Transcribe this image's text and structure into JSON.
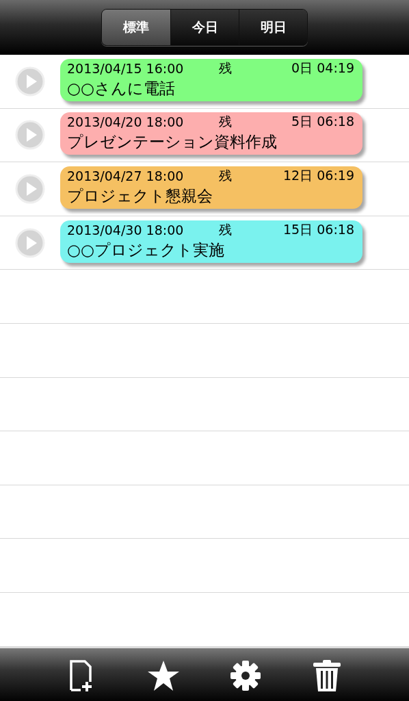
{
  "tabs": [
    {
      "label": "標準",
      "selected": true
    },
    {
      "label": "今日",
      "selected": false
    },
    {
      "label": "明日",
      "selected": false
    }
  ],
  "tasks": [
    {
      "datetime": "2013/04/15 16:00",
      "remaining_label": "残",
      "remaining": "0日 04:19",
      "title": "○○さんに電話",
      "color": "#80fc80"
    },
    {
      "datetime": "2013/04/20 18:00",
      "remaining_label": "残",
      "remaining": "5日 06:18",
      "title": "プレゼンテーション資料作成",
      "color": "#fdaeae"
    },
    {
      "datetime": "2013/04/27 18:00",
      "remaining_label": "残",
      "remaining": "12日 06:19",
      "title": "プロジェクト懇親会",
      "color": "#f5c062"
    },
    {
      "datetime": "2013/04/30 18:00",
      "remaining_label": "残",
      "remaining": "15日 06:18",
      "title": "○○プロジェクト実施",
      "color": "#7af2ee"
    }
  ]
}
